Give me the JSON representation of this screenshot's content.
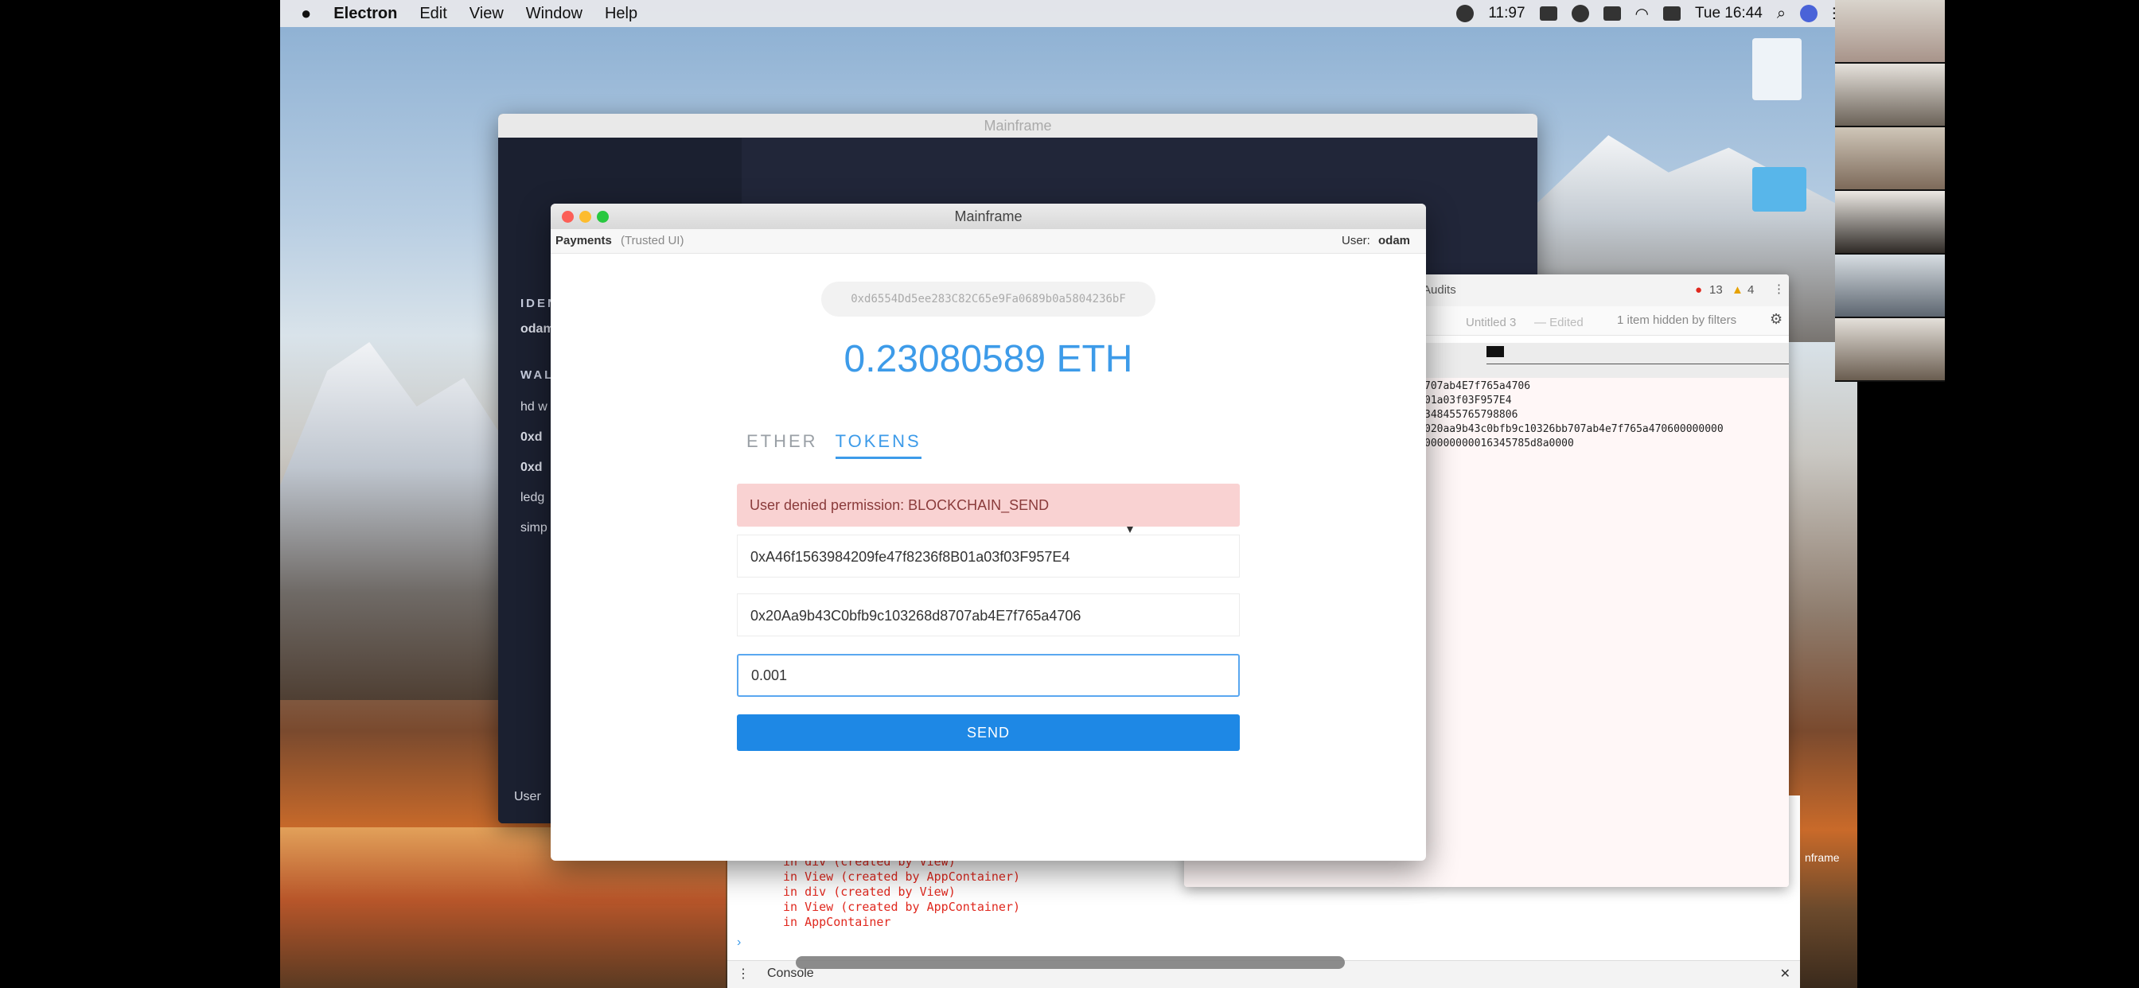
{
  "menubar": {
    "apple": "",
    "app": "Electron",
    "items": [
      "Edit",
      "View",
      "Window",
      "Help"
    ],
    "battery_time": "11:97",
    "clock": "Tue 16:44"
  },
  "bg_window": {
    "title": "Mainframe",
    "identities_heading": "IDENTITIES",
    "identity": "odam",
    "wallets_heading": "WAL",
    "wallet_items": [
      "hd w",
      "0xd",
      "0xd",
      "ledg",
      "simp"
    ],
    "footer": "User"
  },
  "main_window": {
    "title": "Mainframe",
    "subtitle": "Payments",
    "subtitle_note": "(Trusted UI)",
    "user_label": "User:",
    "user_name": "odam",
    "address": "0xd6554Dd5ee283C82C65e9Fa0689b0a5804236bF",
    "balance": "0.23080589 ETH",
    "tabs": {
      "ether": "ETHER",
      "tokens": "TOKENS"
    },
    "error": "User denied permission: BLOCKCHAIN_SEND",
    "from_address": "0xA46f1563984209fe47f8236f8B01a03f03F957E4",
    "to_address": "0x20Aa9b43C0bfb9c103268d8707ab4E7f765a4706",
    "amount": "0.001",
    "send_label": "SEND"
  },
  "devtools": {
    "panel": "Audits",
    "errors": "13",
    "warnings": "4",
    "hidden_note": "1 item hidden by filters",
    "doc_title": "Untitled 3",
    "doc_state": "— Edited",
    "code_lines": [
      "707ab4E7f765a4706",
      "01a03f03F957E4",
      "348455765798806",
      "",
      "020aa9b43c0bfb9c10326bb707ab4e7f765a470600000000",
      "00000000016345785d8a0000"
    ],
    "console_lines": [
      "in div (created by View)",
      "in View (created by AppContainer)",
      "in div (created by View)",
      "in View (created by AppContainer)",
      "in AppContainer"
    ],
    "console_tab": "Console",
    "desktop_label": "nframe"
  },
  "colors": {
    "accent": "#1e88e5",
    "balance": "#3d9be9",
    "error_bg": "#f9d2d2"
  }
}
